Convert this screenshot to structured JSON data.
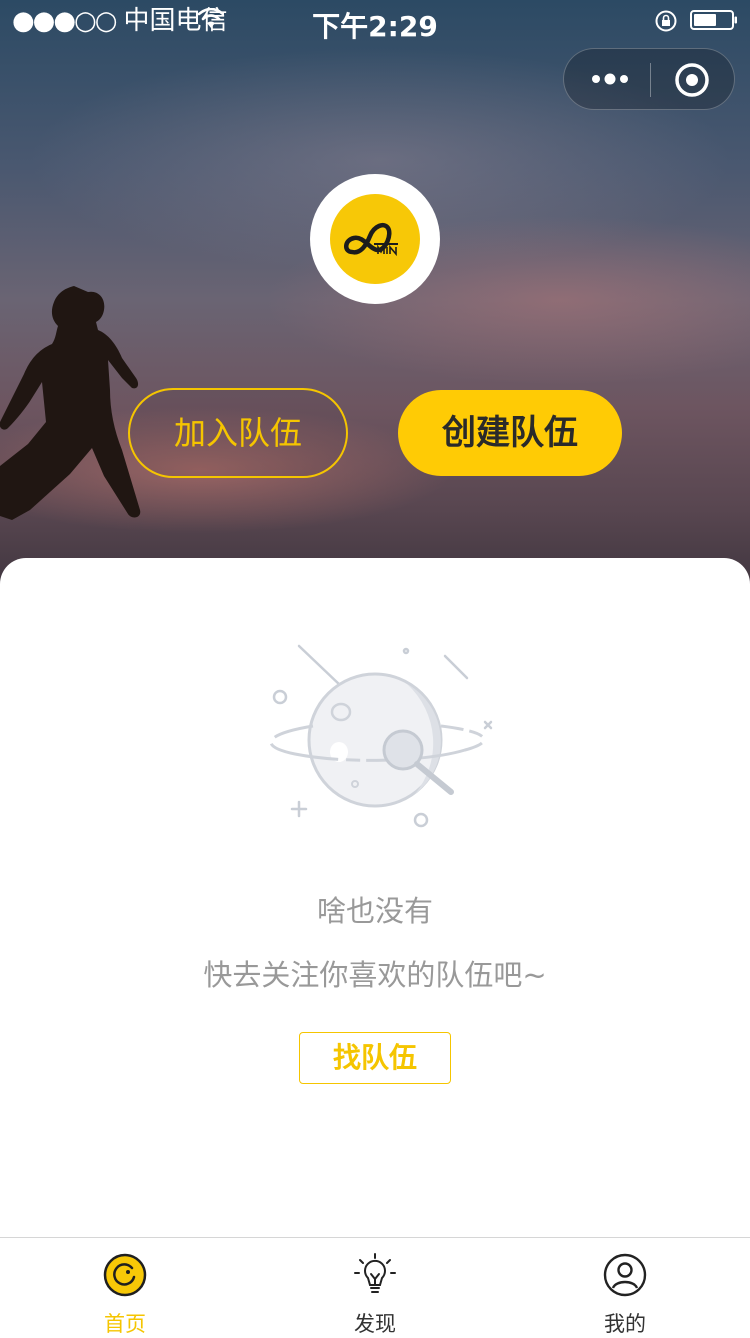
{
  "status_bar": {
    "signal_dots": "●●●○○",
    "carrier": "中国电信",
    "time": "下午2:29"
  },
  "hero": {
    "join_label": "加入队伍",
    "create_label": "创建队伍"
  },
  "empty_state": {
    "title": "啥也没有",
    "subtitle": "快去关注你喜欢的队伍吧~",
    "find_label": "找队伍"
  },
  "tabbar": {
    "items": [
      {
        "label": "首页",
        "icon": "home-icon",
        "active": true
      },
      {
        "label": "发现",
        "icon": "lightbulb-icon",
        "active": false
      },
      {
        "label": "我的",
        "icon": "user-icon",
        "active": false
      }
    ]
  },
  "colors": {
    "accent": "#ffcb05",
    "accent_text": "#f5c500",
    "muted_text": "#999999"
  }
}
